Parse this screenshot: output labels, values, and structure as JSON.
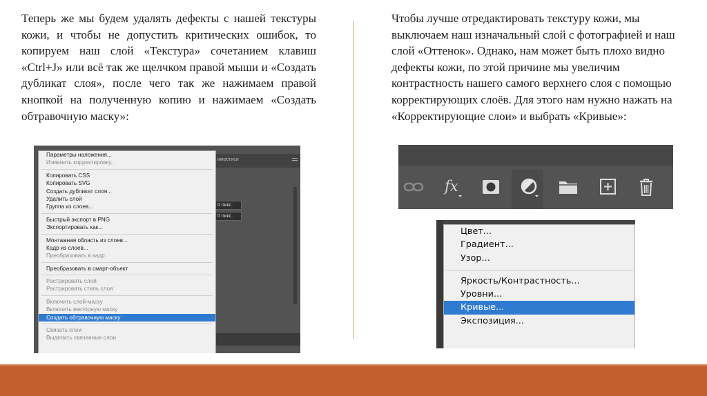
{
  "left_paragraph": "Теперь же мы будем удалять дефекты с нашей текстуры кожи, и чтобы не допустить критических ошибок, то копируем наш слой «Текстура» сочетанием клавиш «Ctrl+J» или всё так же щелчком правой мыши и «Создать дубликат слоя», после чего так же нажимаем правой кнопкой на полученную копию и нажимаем «Создать обтравочную маску»:",
  "right_paragraph": "Чтобы лучше отредактировать текстуру кожи, мы выключаем наш изначальный слой с фотографией и наш слой «Оттенок». Однако, нам может быть плохо видно дефекты кожи, по этой причине мы увеличим контрастность нашего самого верхнего слоя с помощью корректирующих слоёв. Для этого нам нужно нажать на «Корректирующие слои» и выбрать «Кривые»:",
  "context_menu": {
    "groups": [
      [
        {
          "label": "Параметры наложения...",
          "state": "normal"
        },
        {
          "label": "Изменить корректировку...",
          "state": "disabled"
        }
      ],
      [
        {
          "label": "Копировать CSS",
          "state": "normal"
        },
        {
          "label": "Копировать SVG",
          "state": "normal"
        },
        {
          "label": "Создать дубликат слоя...",
          "state": "normal"
        },
        {
          "label": "Удалить слой",
          "state": "normal"
        },
        {
          "label": "Группа из слоев...",
          "state": "normal"
        }
      ],
      [
        {
          "label": "Быстрый экспорт в PNG",
          "state": "normal"
        },
        {
          "label": "Экспортировать как...",
          "state": "normal"
        }
      ],
      [
        {
          "label": "Монтажная область из слоев...",
          "state": "normal"
        },
        {
          "label": "Кадр из слоев...",
          "state": "normal"
        },
        {
          "label": "Преобразовать в кадр",
          "state": "disabled"
        }
      ],
      [
        {
          "label": "Преобразовать в смарт-объект",
          "state": "normal"
        }
      ],
      [
        {
          "label": "Растрировать слой",
          "state": "disabled"
        },
        {
          "label": "Растрировать стиль слоя",
          "state": "disabled"
        }
      ],
      [
        {
          "label": "Включить слой-маску",
          "state": "disabled"
        },
        {
          "label": "Включить векторную маску",
          "state": "disabled"
        },
        {
          "label": "Создать обтравочную маску",
          "state": "selected"
        }
      ],
      [
        {
          "label": "Связать слои",
          "state": "disabled"
        },
        {
          "label": "Выделить связанные слои",
          "state": "disabled"
        }
      ]
    ]
  },
  "ps_panel": {
    "tab_label": "имостиси",
    "field_1": "0 пикс.",
    "field_2": "0 пикс."
  },
  "toolbar": {
    "icons": [
      "link-icon",
      "fx-icon",
      "mask-icon",
      "adjustment-layer-icon",
      "folder-icon",
      "new-layer-icon",
      "trash-icon"
    ]
  },
  "adjustment_menu": {
    "groups": [
      [
        {
          "label": "Цвет...",
          "state": "normal"
        },
        {
          "label": "Градиент...",
          "state": "normal"
        },
        {
          "label": "Узор...",
          "state": "normal"
        }
      ],
      [
        {
          "label": "Яркость/Контрастность...",
          "state": "normal"
        },
        {
          "label": "Уровни...",
          "state": "normal"
        },
        {
          "label": "Кривые...",
          "state": "selected"
        },
        {
          "label": "Экспозиция...",
          "state": "normal"
        }
      ]
    ]
  },
  "colors": {
    "footer": "#c15f2e",
    "divider": "#c9a47f",
    "selection": "#2f7bd1",
    "ps_background": "#535353"
  }
}
